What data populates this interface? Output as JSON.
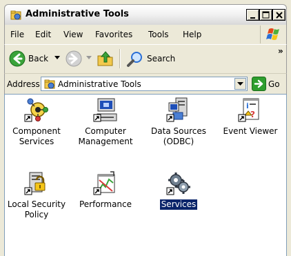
{
  "window": {
    "title": "Administrative Tools"
  },
  "menu": {
    "items": [
      "File",
      "Edit",
      "View",
      "Favorites",
      "Tools",
      "Help"
    ]
  },
  "toolbar": {
    "back_label": "Back",
    "search_label": "Search",
    "overflow_label": "»"
  },
  "address": {
    "label": "Address",
    "value": "Administrative Tools",
    "go_label": "Go"
  },
  "items": [
    {
      "label_lines": [
        "Component",
        "Services"
      ]
    },
    {
      "label_lines": [
        "Computer",
        "Management"
      ]
    },
    {
      "label_lines": [
        "Data Sources",
        "(ODBC)"
      ]
    },
    {
      "label_lines": [
        "Event Viewer"
      ]
    },
    {
      "label_lines": [
        "Local Security",
        "Policy"
      ]
    },
    {
      "label_lines": [
        "Performance"
      ]
    },
    {
      "label_lines": [
        "Services"
      ],
      "selected": true
    }
  ],
  "colors": {
    "selection": "#0a246a",
    "frame": "#ece9d8",
    "go_green": "#2e9e2e",
    "back_green": "#2e9e2e"
  }
}
